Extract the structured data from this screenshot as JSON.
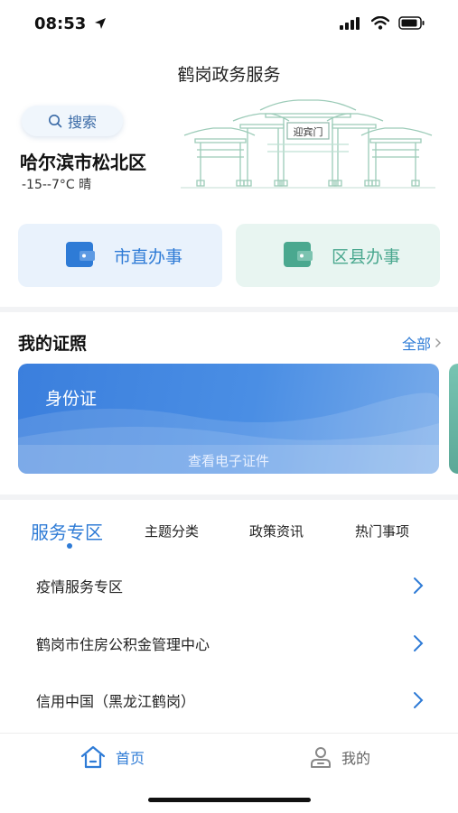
{
  "status": {
    "time": "08:53"
  },
  "header": {
    "title": "鹤岗政务服务"
  },
  "search": {
    "label": "搜索"
  },
  "location": {
    "name": "哈尔滨市松北区",
    "weather": "-15--7°C 晴"
  },
  "gate": {
    "sign": "迎宾门"
  },
  "quick_actions": [
    {
      "label": "市直办事",
      "color": "#2e7bd6"
    },
    {
      "label": "区县办事",
      "color": "#4aa88f"
    }
  ],
  "certificates": {
    "title": "我的证照",
    "more": "全部",
    "card_title": "身份证",
    "card_action": "查看电子证件"
  },
  "tabs": [
    "服务专区",
    "主题分类",
    "政策资讯",
    "热门事项"
  ],
  "list": [
    {
      "label": "疫情服务专区"
    },
    {
      "label": "鹤岗市住房公积金管理中心"
    },
    {
      "label": "信用中国（黑龙江鹤岗）"
    }
  ],
  "bottom_nav": [
    {
      "label": "首页",
      "icon": "home-icon"
    },
    {
      "label": "我的",
      "icon": "user-icon"
    }
  ],
  "colors": {
    "accent": "#2e7bd6",
    "teal": "#4aa88f"
  }
}
